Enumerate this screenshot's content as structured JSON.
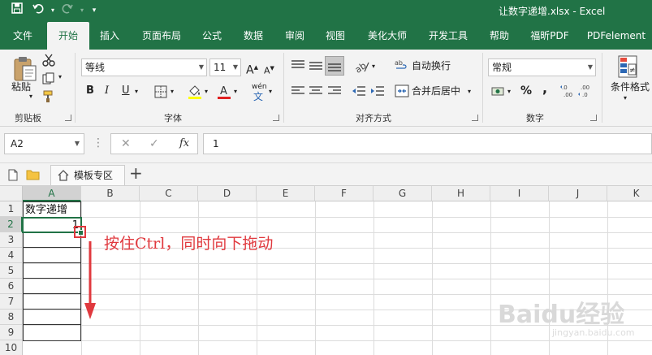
{
  "window": {
    "title": "让数字递增.xlsx  -  Excel",
    "qat": {
      "save_icon": "save-icon",
      "undo_icon": "undo-icon",
      "redo_icon": "redo-icon",
      "customize_icon": "customize-qat-icon"
    }
  },
  "ribbon_tabs": [
    "文件",
    "开始",
    "插入",
    "页面布局",
    "公式",
    "数据",
    "审阅",
    "视图",
    "美化大师",
    "开发工具",
    "帮助",
    "福昕PDF",
    "PDFelement"
  ],
  "active_tab": "开始",
  "clipboard": {
    "paste_label": "粘贴",
    "group_label": "剪贴板"
  },
  "font": {
    "name": "等线",
    "size": "11",
    "group_label": "字体",
    "bold": "B",
    "italic": "I",
    "underline": "U",
    "grow": "A",
    "shrink": "A",
    "phonetic": "wén"
  },
  "alignment": {
    "wrap_text": "自动换行",
    "merge_center": "合并后居中",
    "group_label": "对齐方式"
  },
  "number": {
    "format": "常规",
    "group_label": "数字",
    "percent": "%",
    "comma": ","
  },
  "styles": {
    "conditional_format": "条件格式"
  },
  "formula_bar": {
    "name_box": "A2",
    "cancel": "✕",
    "enter": "✓",
    "fx": "fx",
    "content": "1"
  },
  "sheet_tabs": {
    "template": "模板专区",
    "add": "+"
  },
  "grid": {
    "columns": [
      "A",
      "B",
      "C",
      "D",
      "E",
      "F",
      "G",
      "H",
      "I",
      "J",
      "K"
    ],
    "rows": [
      "1",
      "2",
      "3",
      "4",
      "5",
      "6",
      "7",
      "8",
      "9",
      "10"
    ],
    "selected_column": "A",
    "selected_row": "2",
    "cells": {
      "A1": "数字递增",
      "A2": "1"
    }
  },
  "annotation": {
    "instruction": "按住Ctrl，同时向下拖动"
  },
  "watermark": {
    "brand": "Baidu经验",
    "url": "jingyan.baidu.com"
  },
  "colors": {
    "excel_green": "#217346",
    "annotation_red": "#e0393e"
  }
}
